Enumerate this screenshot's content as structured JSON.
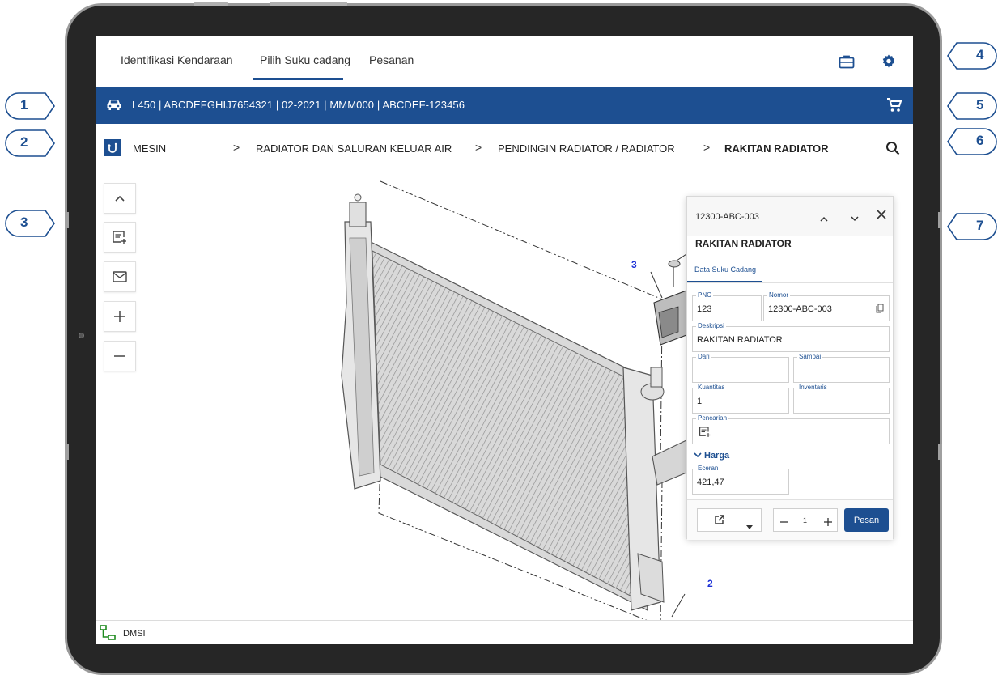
{
  "nav": {
    "tabs": [
      {
        "label": "Identifikasi Kendaraan"
      },
      {
        "label": "Pilih Suku cadang"
      },
      {
        "label": "Pesanan"
      }
    ],
    "icons": [
      "briefcase-icon",
      "gear-icon"
    ]
  },
  "vehicle": {
    "info": "L450 | ABCDEFGHIJ7654321  | 02-2021 | MMM000 | ABCDEF-123456",
    "icons": [
      "car-icon",
      "cart-icon"
    ]
  },
  "breadcrumb": {
    "items": [
      {
        "label": "MESIN"
      },
      {
        "label": "RADIATOR DAN SALURAN KELUAR AIR"
      },
      {
        "label": "PENDINGIN RADIATOR / RADIATOR"
      },
      {
        "label": "RAKITAN RADIATOR"
      }
    ],
    "separator": ">"
  },
  "tools": [
    "chevron-up-icon",
    "add-note-icon",
    "mail-icon",
    "plus-icon",
    "minus-icon"
  ],
  "diagram": {
    "labels": [
      "3",
      "2"
    ]
  },
  "panel": {
    "code": "12300-ABC-003",
    "title": "RAKITAN RADIATOR",
    "tab": "Data Suku Cadang",
    "fields": {
      "pnc_label": "PNC",
      "pnc_value": "123",
      "nomor_label": "Nomor",
      "nomor_value": "12300-ABC-003",
      "deskripsi_label": "Deskripsi",
      "deskripsi_value": "RAKITAN RADIATOR",
      "dari_label": "Dari",
      "dari_value": "",
      "sampai_label": "Sampai",
      "sampai_value": "",
      "kuantitas_label": "Kuantitas",
      "kuantitas_value": "1",
      "inventaris_label": "Inventaris",
      "inventaris_value": "",
      "pencarian_label": "Pencarian"
    },
    "harga_label": "Harga",
    "eceran_label": "Eceran",
    "eceran_value": "421,47",
    "qty_value": "1",
    "order_label": "Pesan"
  },
  "status": {
    "label": "DMSI"
  },
  "callouts": [
    "1",
    "2",
    "3",
    "4",
    "5",
    "6",
    "7"
  ],
  "colors": {
    "brand_blue": "#1d4f91",
    "tablet_frame": "#262626",
    "link_blue": "#1d4f91"
  }
}
